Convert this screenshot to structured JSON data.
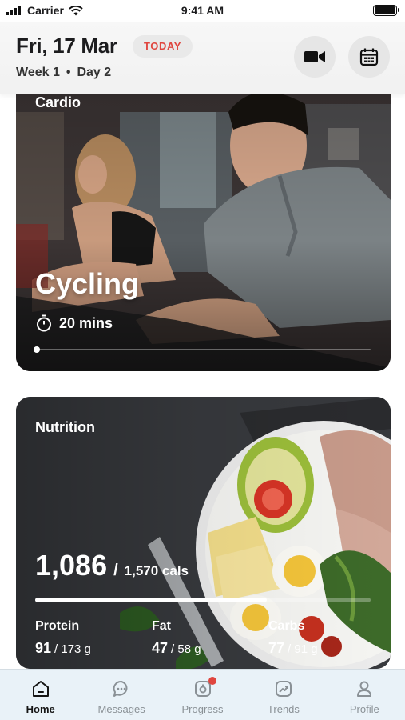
{
  "status_bar": {
    "carrier": "Carrier",
    "time": "9:41 AM"
  },
  "header": {
    "date": "Fri, 17 Mar",
    "today_label": "TODAY",
    "week": "Week 1",
    "day": "Day 2",
    "video_button_icon": "video-camera-icon",
    "calendar_button_icon": "calendar-icon"
  },
  "cardio": {
    "kicker": "Cardio",
    "workout": "Cycling",
    "duration": "20 mins",
    "progress": 0
  },
  "nutrition": {
    "kicker": "Nutrition",
    "calories": "1,086",
    "calorie_goal": "1,570 cals",
    "progress": 0.69,
    "macros": [
      {
        "label": "Protein",
        "value": "91",
        "total": "/ 173 g"
      },
      {
        "label": "Fat",
        "value": "47",
        "total": "/ 58 g"
      },
      {
        "label": "Carbs",
        "value": "77",
        "total": "/ 91 g"
      }
    ]
  },
  "tabs": [
    {
      "label": "Home",
      "icon": "home-icon",
      "active": true
    },
    {
      "label": "Messages",
      "icon": "chat-bubble-icon",
      "active": false
    },
    {
      "label": "Progress",
      "icon": "progress-icon",
      "active": false,
      "badge": true
    },
    {
      "label": "Trends",
      "icon": "trends-icon",
      "active": false
    },
    {
      "label": "Profile",
      "icon": "user-icon",
      "active": false
    }
  ],
  "colors": {
    "accent": "#e0463f",
    "tab_bar": "#e9f2f8",
    "active_tab": "#151515",
    "inactive_tab": "#8a9196"
  }
}
